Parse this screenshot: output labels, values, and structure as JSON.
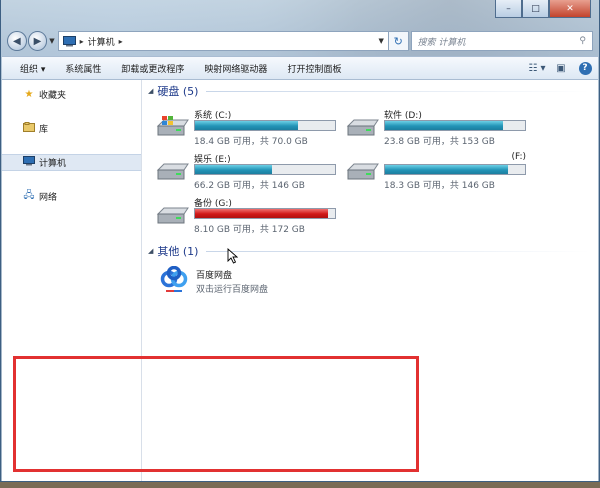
{
  "window": {
    "controls": {
      "minimize": "–",
      "maximize": "□",
      "close": "✕"
    }
  },
  "address": {
    "path": [
      "计算机"
    ],
    "search_placeholder": "搜索 计算机"
  },
  "toolbar": {
    "items": [
      "组织 ▾",
      "系统属性",
      "卸载或更改程序",
      "映射网络驱动器",
      "打开控制面板"
    ]
  },
  "nav": {
    "items": [
      "收藏夹",
      "库",
      "计算机",
      "网络"
    ],
    "selected": "计算机"
  },
  "groups": {
    "hard_disks": "硬盘 (5)",
    "other": "其他 (1)"
  },
  "drives": [
    {
      "name": "系统 (C:)",
      "free_text": "18.4 GB 可用，共 70.0 GB",
      "used_fraction": 0.737
    },
    {
      "name": "软件 (D:)",
      "free_text": "23.8 GB 可用，共 153 GB",
      "used_fraction": 0.844
    },
    {
      "name": "娱乐 (E:)",
      "free_text": "66.2 GB 可用，共 146 GB",
      "used_fraction": 0.547
    },
    {
      "name": "(F:)",
      "free_text": "18.3 GB 可用，共 146 GB",
      "used_fraction": 0.875
    },
    {
      "name": "备份 (G:)",
      "free_text": "8.10 GB 可用，共 172 GB",
      "used_fraction": 0.953,
      "warning": true
    }
  ],
  "apps": [
    {
      "name": "百度网盘",
      "description": "双击运行百度网盘"
    }
  ],
  "colors": {
    "bar_normal": "#2394b7",
    "bar_warning": "#d01818",
    "group_header": "#1e3a8a",
    "annotation_box": "#e23131"
  }
}
